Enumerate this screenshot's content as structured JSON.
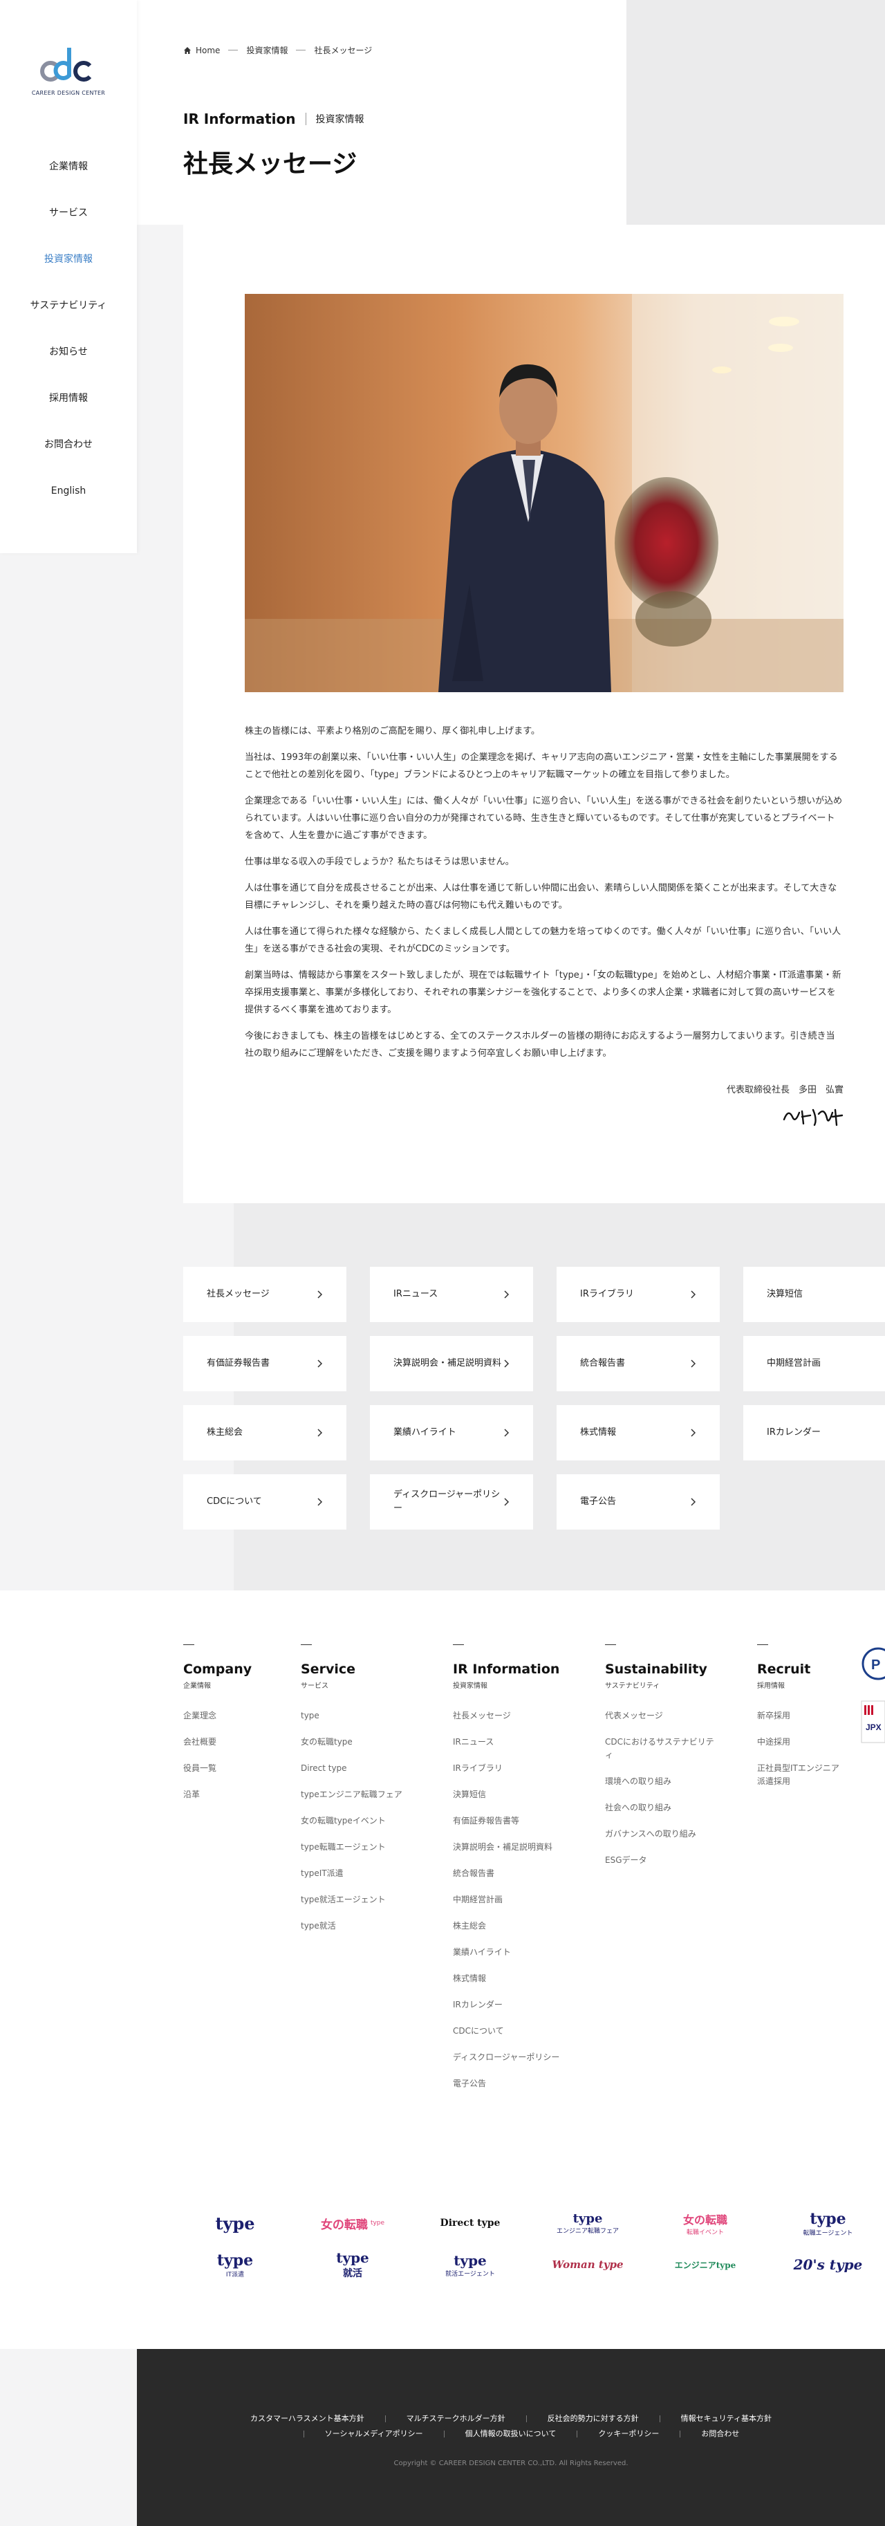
{
  "logo": {
    "mark": "cdc",
    "text": "CAREER DESIGN CENTER"
  },
  "nav": [
    "企業情報",
    "サービス",
    "投資家情報",
    "サステナビリティ",
    "お知らせ",
    "採用情報",
    "お問合わせ",
    "English"
  ],
  "breadcrumb": {
    "home": "Home",
    "parent": "投資家情報",
    "current": "社長メッセージ"
  },
  "section": {
    "en": "IR Information",
    "ja": "投資家情報"
  },
  "page_title": "社長メッセージ",
  "message": {
    "paragraphs": [
      "株主の皆様には、平素より格別のご高配を賜り、厚く御礼申し上げます。",
      "当社は、1993年の創業以来、「いい仕事・いい人生」の企業理念を掲げ、キャリア志向の高いエンジニア・営業・女性を主軸にした事業展開をすることで他社との差別化を図り、「type」ブランドによるひとつ上のキャリア転職マーケットの確立を目指して参りました。",
      "企業理念である「いい仕事・いい人生」には、働く人々が「いい仕事」に巡り合い、「いい人生」を送る事ができる社会を創りたいという想いが込められています。人はいい仕事に巡り合い自分の力が発揮されている時、生き生きと輝いているものです。そして仕事が充実しているとプライベートを含めて、人生を豊かに過ごす事ができます。",
      "仕事は単なる収入の手段でしょうか？私たちはそうは思いません。",
      "人は仕事を通じて自分を成長させることが出来、人は仕事を通じて新しい仲間に出会い、素晴らしい人間関係を築くことが出来ます。そして大きな目標にチャレンジし、それを乗り越えた時の喜びは何物にも代え難いものです。",
      "人は仕事を通じて得られた様々な経験から、たくましく成長し人間としての魅力を培ってゆくのです。働く人々が「いい仕事」に巡り合い、「いい人生」を送る事ができる社会の実現、それがCDCのミッションです。",
      "創業当時は、情報誌から事業をスタート致しましたが、現在では転職サイト「type」・「女の転職type」を始めとし、人材紹介事業・IT派遣事業・新卒採用支援事業と、事業が多様化しており、それぞれの事業シナジーを強化することで、より多くの求人企業・求職者に対して質の高いサービスを提供するべく事業を進めております。",
      "今後におきましても、株主の皆様をはじめとする、全てのステークスホルダーの皆様の期待にお応えするよう一層努力してまいります。引き続き当社の取り組みにご理解をいただき、ご支援を賜りますよう何卒宜しくお願い申し上げます。"
    ],
    "signer": "代表取締役社長　多田　弘實"
  },
  "link_buttons": [
    "社長メッセージ",
    "IRニュース",
    "IRライブラリ",
    "決算短信",
    "有価証券報告書",
    "決算説明会・補足説明資料",
    "統合報告書",
    "中期経営計画",
    "株主総会",
    "業績ハイライト",
    "株式情報",
    "IRカレンダー",
    "CDCについて",
    "ディスクロージャーポリシー",
    "電子公告"
  ],
  "footer_columns": [
    {
      "title": "Company",
      "sub": "企業情報",
      "links": [
        "企業理念",
        "会社概要",
        "役員一覧",
        "沿革"
      ]
    },
    {
      "title": "Service",
      "sub": "サービス",
      "links": [
        "type",
        "女の転職type",
        "Direct type",
        "typeエンジニア転職フェア",
        "女の転職typeイベント",
        "type転職エージェント",
        "typeIT派遣",
        "type就活エージェント",
        "type就活"
      ]
    },
    {
      "title": "IR Information",
      "sub": "投資家情報",
      "links": [
        "社長メッセージ",
        "IRニュース",
        "IRライブラリ",
        "決算短信",
        "有価証券報告書等",
        "決算説明会・補足説明資料",
        "統合報告書",
        "中期経営計画",
        "株主総会",
        "業績ハイライト",
        "株式情報",
        "IRカレンダー",
        "CDCについて",
        "ディスクロージャーポリシー",
        "電子公告"
      ]
    },
    {
      "title": "Sustainability",
      "sub": "サステナビリティ",
      "links": [
        "代表メッセージ",
        "CDCにおけるサステナビリティ",
        "環境への取り組み",
        "社会への取り組み",
        "ガバナンスへの取り組み",
        "ESGデータ"
      ]
    },
    {
      "title": "Recruit",
      "sub": "採用情報",
      "links": [
        "新卒採用",
        "中途採用",
        "正社員型ITエンジニア派遣採用"
      ]
    }
  ],
  "side_badges": [
    "P",
    "JPX"
  ],
  "brands": [
    {
      "main": "type",
      "sub": ""
    },
    {
      "main": "女の転職",
      "sub": "type"
    },
    {
      "main": "Direct type",
      "sub": ""
    },
    {
      "main": "type",
      "sub": "エンジニア転職フェア"
    },
    {
      "main": "女の転職",
      "sub": "転職イベント"
    },
    {
      "main": "type",
      "sub": "転職エージェント"
    },
    {
      "main": "type",
      "sub": "IT派遣"
    },
    {
      "main": "type",
      "sub": "就活"
    },
    {
      "main": "type",
      "sub": "就活エージェント"
    },
    {
      "main": "Woman type",
      "sub": ""
    },
    {
      "main": "エンジニアtype",
      "sub": ""
    },
    {
      "main": "20's type",
      "sub": ""
    }
  ],
  "footer_links_row1": [
    "カスタマーハラスメント基本方針",
    "マルチステークホルダー方針",
    "反社会的勢力に対する方針",
    "情報セキュリティ基本方針"
  ],
  "footer_links_row2": [
    "ソーシャルメディアポリシー",
    "個人情報の取扱いについて",
    "クッキーポリシー",
    "お問合わせ"
  ],
  "copyright": "Copyright © CAREER DESIGN CENTER CO.,LTD. All Rights Reserved.",
  "colors": {
    "accent": "#3d80c7",
    "brand_navy": "#1b1f6e",
    "footer_bg": "#2a2a2a"
  }
}
